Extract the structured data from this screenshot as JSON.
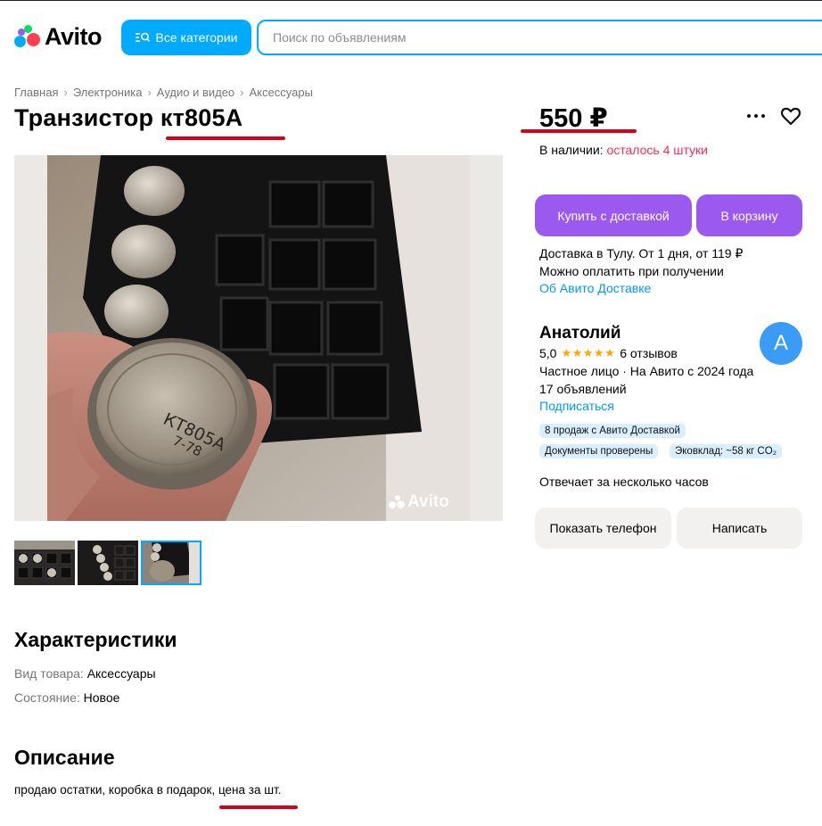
{
  "header": {
    "logo_text": "Avito",
    "categories_button": "Все категории",
    "search_placeholder": "Поиск по объявлениям"
  },
  "breadcrumb": [
    "Главная",
    "Электроника",
    "Аудио и видео",
    "Аксессуары"
  ],
  "listing": {
    "title": "Транзистор кт805А",
    "price": "550 ₽",
    "availability_label": "В наличии:",
    "availability_value": "осталось 4 штуки",
    "photo_watermark": "Avito",
    "thumbnails_count": 3,
    "active_thumbnail": 3
  },
  "actions": {
    "buy_with_delivery": "Купить с доставкой",
    "add_to_cart": "В корзину",
    "show_phone": "Показать телефон",
    "write_message": "Написать"
  },
  "delivery": {
    "line1": "Доставка в Тулу. От 1 дня, от 119 ₽",
    "line2": "Можно оплатить при получении",
    "link": "Об Авито Доставке"
  },
  "seller": {
    "name": "Анатолий",
    "avatar_letter": "A",
    "rating": "5,0",
    "stars": "★★★★★",
    "reviews": "6 отзывов",
    "info_line": "Частное лицо · На Авито с 2024 года",
    "listings_count": "17 объявлений",
    "subscribe": "Подписаться",
    "badges": [
      "8 продаж с Авито Доставкой",
      "Документы проверены",
      "Эковклад: ~58 кг CO₂"
    ],
    "response_time": "Отвечает за несколько часов"
  },
  "characteristics": {
    "heading": "Характеристики",
    "items": [
      {
        "key": "Вид товара:",
        "value": "Аксессуары"
      },
      {
        "key": "Состояние:",
        "value": "Новое"
      }
    ]
  },
  "description": {
    "heading": "Описание",
    "text": "продаю остатки, коробка в подарок, цена за шт."
  },
  "colors": {
    "accent_blue": "#00aaff",
    "purple_button": "#9b59f0",
    "availability_red": "#ff2a50",
    "annotation_red": "#d9001b",
    "link_blue": "#0099f7"
  }
}
